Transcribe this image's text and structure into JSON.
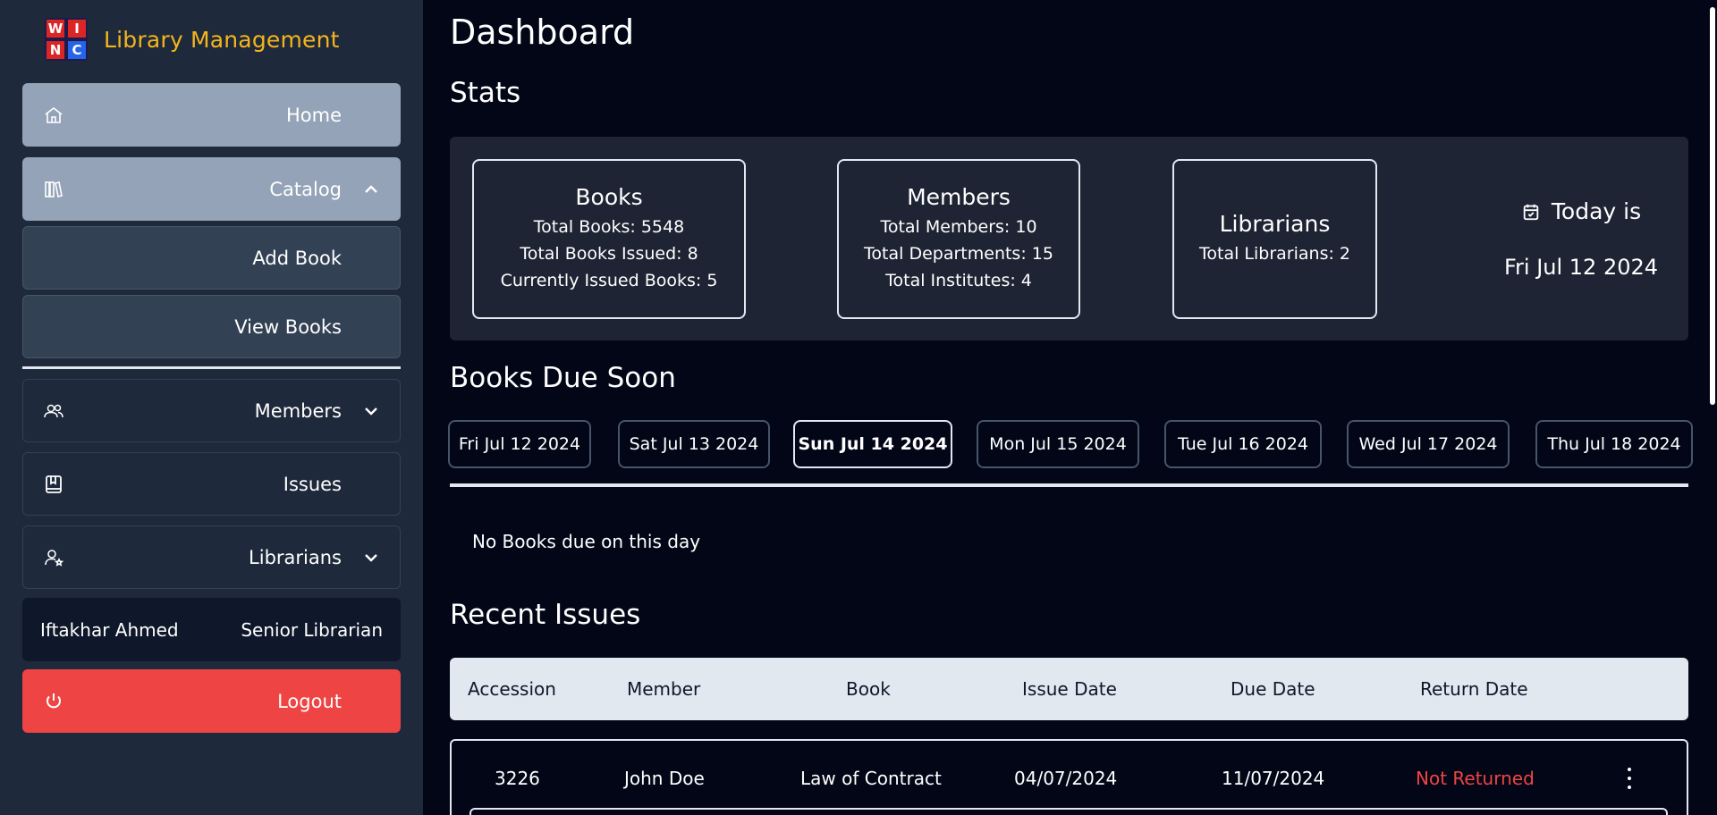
{
  "brand": {
    "logo_letters": [
      "W",
      "I",
      "N",
      "C"
    ],
    "name": "Library Management"
  },
  "sidebar": {
    "items": [
      {
        "label": "Home",
        "icon": "home-icon"
      },
      {
        "label": "Catalog",
        "icon": "books-icon",
        "expanded": true
      },
      {
        "label": "Add Book"
      },
      {
        "label": "View Books"
      },
      {
        "label": "Members",
        "icon": "users-icon",
        "expanded": false
      },
      {
        "label": "Issues",
        "icon": "book-issue-icon"
      },
      {
        "label": "Librarians",
        "icon": "user-star-icon",
        "expanded": false
      }
    ],
    "user": {
      "name": "Iftakhar Ahmed",
      "role": "Senior Librarian"
    },
    "logout_label": "Logout"
  },
  "main": {
    "title": "Dashboard",
    "stats_title": "Stats",
    "stats": {
      "books": {
        "title": "Books",
        "lines": [
          "Total Books: 5548",
          "Total Books Issued: 8",
          "Currently Issued Books: 5"
        ]
      },
      "members": {
        "title": "Members",
        "lines": [
          "Total Members: 10",
          "Total Departments: 15",
          "Total Institutes: 4"
        ]
      },
      "librarians": {
        "title": "Librarians",
        "lines": [
          "Total Librarians: 2"
        ]
      },
      "today": {
        "label": "Today is",
        "date": "Fri Jul 12 2024",
        "icon": "calendar-check-icon"
      }
    },
    "due_soon_title": "Books Due Soon",
    "due_days": [
      "Fri Jul 12 2024",
      "Sat Jul 13 2024",
      "Sun Jul 14 2024",
      "Mon Jul 15 2024",
      "Tue Jul 16 2024",
      "Wed Jul 17 2024",
      "Thu Jul 18 2024"
    ],
    "active_day": "Sun Jul 14 2024",
    "empty_message": "No Books due on this day",
    "recent_title": "Recent Issues",
    "table": {
      "columns": [
        "Accession",
        "Member",
        "Book",
        "Issue Date",
        "Due Date",
        "Return Date"
      ],
      "rows": [
        {
          "accession": "3226",
          "member": "John Doe",
          "book": "Law of Contract",
          "issue_date": "04/07/2024",
          "due_date": "11/07/2024",
          "return_date": "Not Returned"
        }
      ]
    }
  },
  "colors": {
    "background": "#020617",
    "sidebar": "#1e293b",
    "brand": "#f5b51c",
    "active_nav": "#94a3b8",
    "logout": "#ef4444",
    "not_returned": "#ef4444"
  }
}
